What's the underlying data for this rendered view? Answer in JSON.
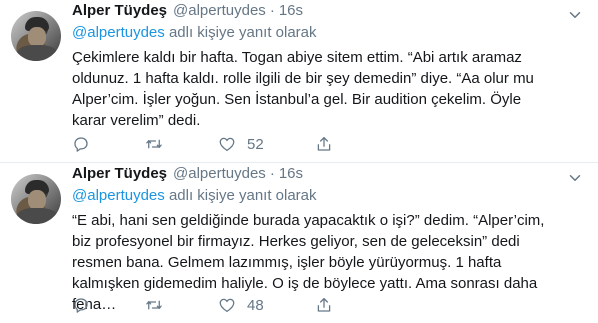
{
  "colors": {
    "text": "#14171a",
    "muted": "#657786",
    "link": "#1b95e0",
    "divider": "#e6ecf0"
  },
  "tweets": [
    {
      "author_name": "Alper Tüydeş",
      "handle": "@alpertuydes",
      "separator": "·",
      "time": "16s",
      "reply_mention": "@alpertuydes",
      "reply_suffix": " adlı kişiye yanıt olarak",
      "text": "Çekimlere kaldı bir hafta. Togan abiye sitem ettim. “Abi artık aramaz oldunuz. 1 hafta kaldı. rolle ilgili de bir şey demedin” diye. “Aa olur mu Alper’cim. İşler yoğun. Sen İstanbul’a gel. Bir audition çekelim. Öyle karar verelim” dedi.",
      "like_count": "52",
      "icons": [
        "avatar",
        "chevron-down-icon",
        "reply-icon",
        "retweet-icon",
        "like-icon",
        "share-icon"
      ]
    },
    {
      "author_name": "Alper Tüydeş",
      "handle": "@alpertuydes",
      "separator": "·",
      "time": "16s",
      "reply_mention": "@alpertuydes",
      "reply_suffix": " adlı kişiye yanıt olarak",
      "text": "“E abi, hani sen geldiğinde burada yapacaktık o işi?” dedim. “Alper’cim, biz profesyonel bir firmayız. Herkes geliyor, sen de geleceksin” dedi resmen bana. Gelmem lazımmış, işler böyle yürüyormuş. 1 hafta kalmışken gidemedim haliyle. O iş de böylece yattı. Ama sonrası daha fena…",
      "like_count": "48",
      "icons": [
        "avatar",
        "chevron-down-icon",
        "reply-icon",
        "retweet-icon",
        "like-icon",
        "share-icon"
      ]
    }
  ]
}
